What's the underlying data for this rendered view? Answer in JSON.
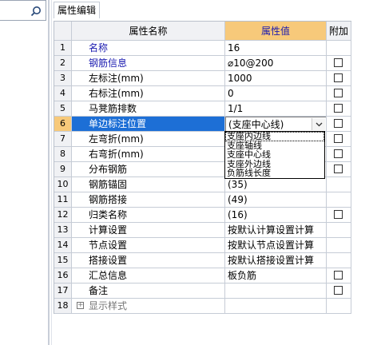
{
  "panel": {
    "tab_label": "属性编辑"
  },
  "header": {
    "num": "",
    "name": "属性名称",
    "value": "属性值",
    "add": "附加"
  },
  "rows": [
    {
      "num": "1",
      "name": "名称",
      "value": "16",
      "checkbox": false,
      "blue": true
    },
    {
      "num": "2",
      "name": "钢筋信息",
      "value": "⌀10@200",
      "checkbox": true,
      "blue": true
    },
    {
      "num": "3",
      "name": "左标注(mm)",
      "value": "1000",
      "checkbox": true
    },
    {
      "num": "4",
      "name": "右标注(mm)",
      "value": "0",
      "checkbox": true
    },
    {
      "num": "5",
      "name": "马凳筋排数",
      "value": "1/1",
      "checkbox": true
    },
    {
      "num": "6",
      "name": "单边标注位置",
      "value": "(支座中心线)",
      "checkbox": true,
      "selected": true
    },
    {
      "num": "7",
      "name": "左弯折(mm)",
      "value": "",
      "checkbox": true
    },
    {
      "num": "8",
      "name": "右弯折(mm)",
      "value": "",
      "checkbox": true
    },
    {
      "num": "9",
      "name": "分布钢筋",
      "value": "",
      "checkbox": true
    },
    {
      "num": "10",
      "name": "钢筋锚固",
      "value": "(35)",
      "checkbox": false
    },
    {
      "num": "11",
      "name": "钢筋搭接",
      "value": "(49)",
      "checkbox": false
    },
    {
      "num": "12",
      "name": "归类名称",
      "value": "(16)",
      "checkbox": true
    },
    {
      "num": "13",
      "name": "计算设置",
      "value": "按默认计算设置计算",
      "checkbox": false
    },
    {
      "num": "14",
      "name": "节点设置",
      "value": "按默认节点设置计算",
      "checkbox": false
    },
    {
      "num": "15",
      "name": "搭接设置",
      "value": "按默认搭接设置计算",
      "checkbox": false
    },
    {
      "num": "16",
      "name": "汇总信息",
      "value": "板负筋",
      "checkbox": true
    },
    {
      "num": "17",
      "name": "备注",
      "value": "",
      "checkbox": true
    },
    {
      "num": "18",
      "name": "显示样式",
      "value": "",
      "checkbox": false,
      "expandable": true
    }
  ],
  "dropdown": {
    "options": [
      "支座内边线",
      "支座轴线",
      "支座中心线",
      "支座外边线",
      "负筋线长度"
    ],
    "highlighted_index": 0
  },
  "colors": {
    "header_value_bg": "#f7c97a",
    "selected_row_bg": "#1d6fd6",
    "blue_text": "#1a1ab0"
  },
  "icons": {
    "search": "search-icon",
    "dropdown": "chevron-down-icon",
    "expand": "plus-icon"
  }
}
